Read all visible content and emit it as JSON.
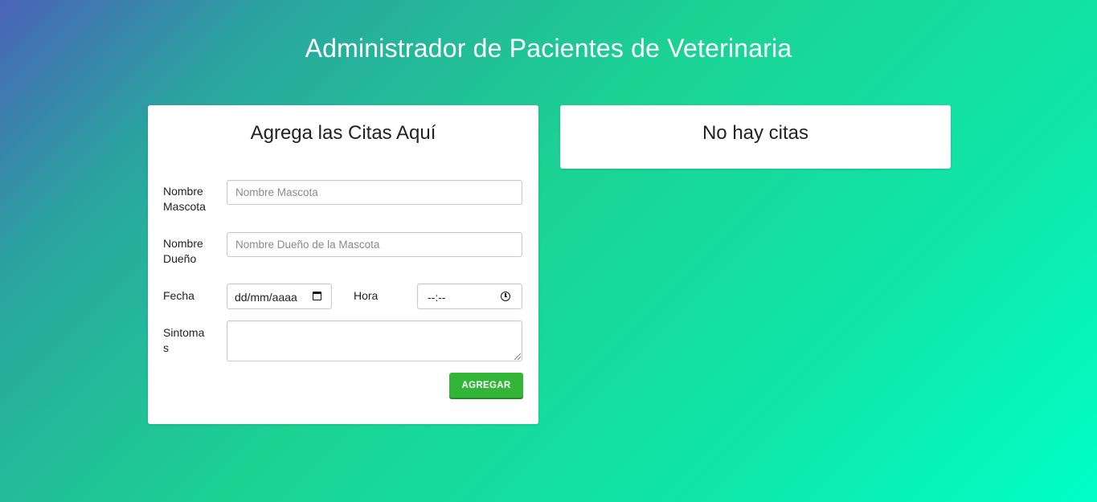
{
  "header": {
    "title": "Administrador de Pacientes de Veterinaria"
  },
  "form": {
    "title": "Agrega las Citas Aquí",
    "pet_name": {
      "label_line1": "Nombre",
      "label_line2": "Mascota",
      "placeholder": "Nombre Mascota",
      "value": ""
    },
    "owner_name": {
      "label_line1": "Nombre",
      "label_line2": "Dueño",
      "placeholder": "Nombre Dueño de la Mascota",
      "value": ""
    },
    "date": {
      "label": "Fecha",
      "placeholder": "dd/mm/aaaa",
      "icon": "calendar-icon"
    },
    "time": {
      "label": "Hora",
      "placeholder": "--:--",
      "icon": "clock-icon"
    },
    "symptoms": {
      "label_line1": "Sintoma",
      "label_line2": "s",
      "value": ""
    },
    "submit_label": "AGREGAR"
  },
  "appointments": {
    "empty_title": "No hay citas"
  },
  "colors": {
    "gradient_start": "#4a63b8",
    "gradient_end": "#00ffc8",
    "button": "#33b637",
    "card": "#ffffff"
  }
}
